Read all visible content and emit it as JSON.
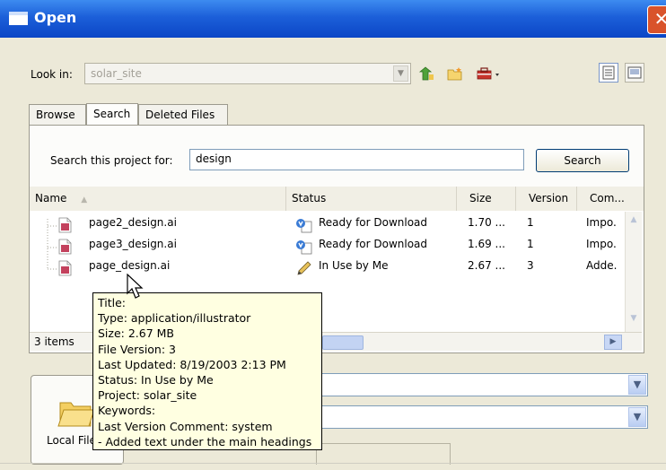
{
  "window": {
    "title": "Open",
    "close_glyph": "✕"
  },
  "toolbar": {
    "look_in_label": "Look in:",
    "look_in_value": "solar_site",
    "icons": [
      "up-folder-icon",
      "new-folder-icon",
      "tools-icon"
    ],
    "views": [
      "details-view-icon",
      "thumbnail-view-icon"
    ]
  },
  "tabs": [
    "Browse",
    "Search",
    "Deleted Files"
  ],
  "active_tab": "Search",
  "search": {
    "label": "Search this project for:",
    "value": "design",
    "button": "Search"
  },
  "columns": [
    "Name",
    "Status",
    "Size",
    "Version",
    "Com..."
  ],
  "files": [
    {
      "name": "page2_design.ai",
      "status": "Ready for Download",
      "size": "1.70 ...",
      "version": "1",
      "comment": "Impo.",
      "status_icon": "download-icon"
    },
    {
      "name": "page3_design.ai",
      "status": "Ready for Download",
      "size": "1.69 ...",
      "version": "1",
      "comment": "Impo.",
      "status_icon": "download-icon"
    },
    {
      "name": "page_design.ai",
      "status": "In Use by Me",
      "size": "2.67 ...",
      "version": "3",
      "comment": "Adde.",
      "status_icon": "pencil-icon"
    }
  ],
  "items_count": "3 items",
  "local_files_label": "Local Files",
  "tooltip": [
    "Title:",
    "Type: application/illustrator",
    "Size: 2.67 MB",
    "File Version: 3",
    "Last Updated: 8/19/2003 2:13 PM",
    "Status: In Use by Me",
    "Project: solar_site",
    "Keywords:",
    "Last Version Comment: system",
    "- Added text under the main headings"
  ],
  "colors": {
    "titlebar": "#0b46c6",
    "window_bg": "#ece9d8",
    "tooltip_bg": "#ffffe1",
    "close": "#d9532b"
  }
}
